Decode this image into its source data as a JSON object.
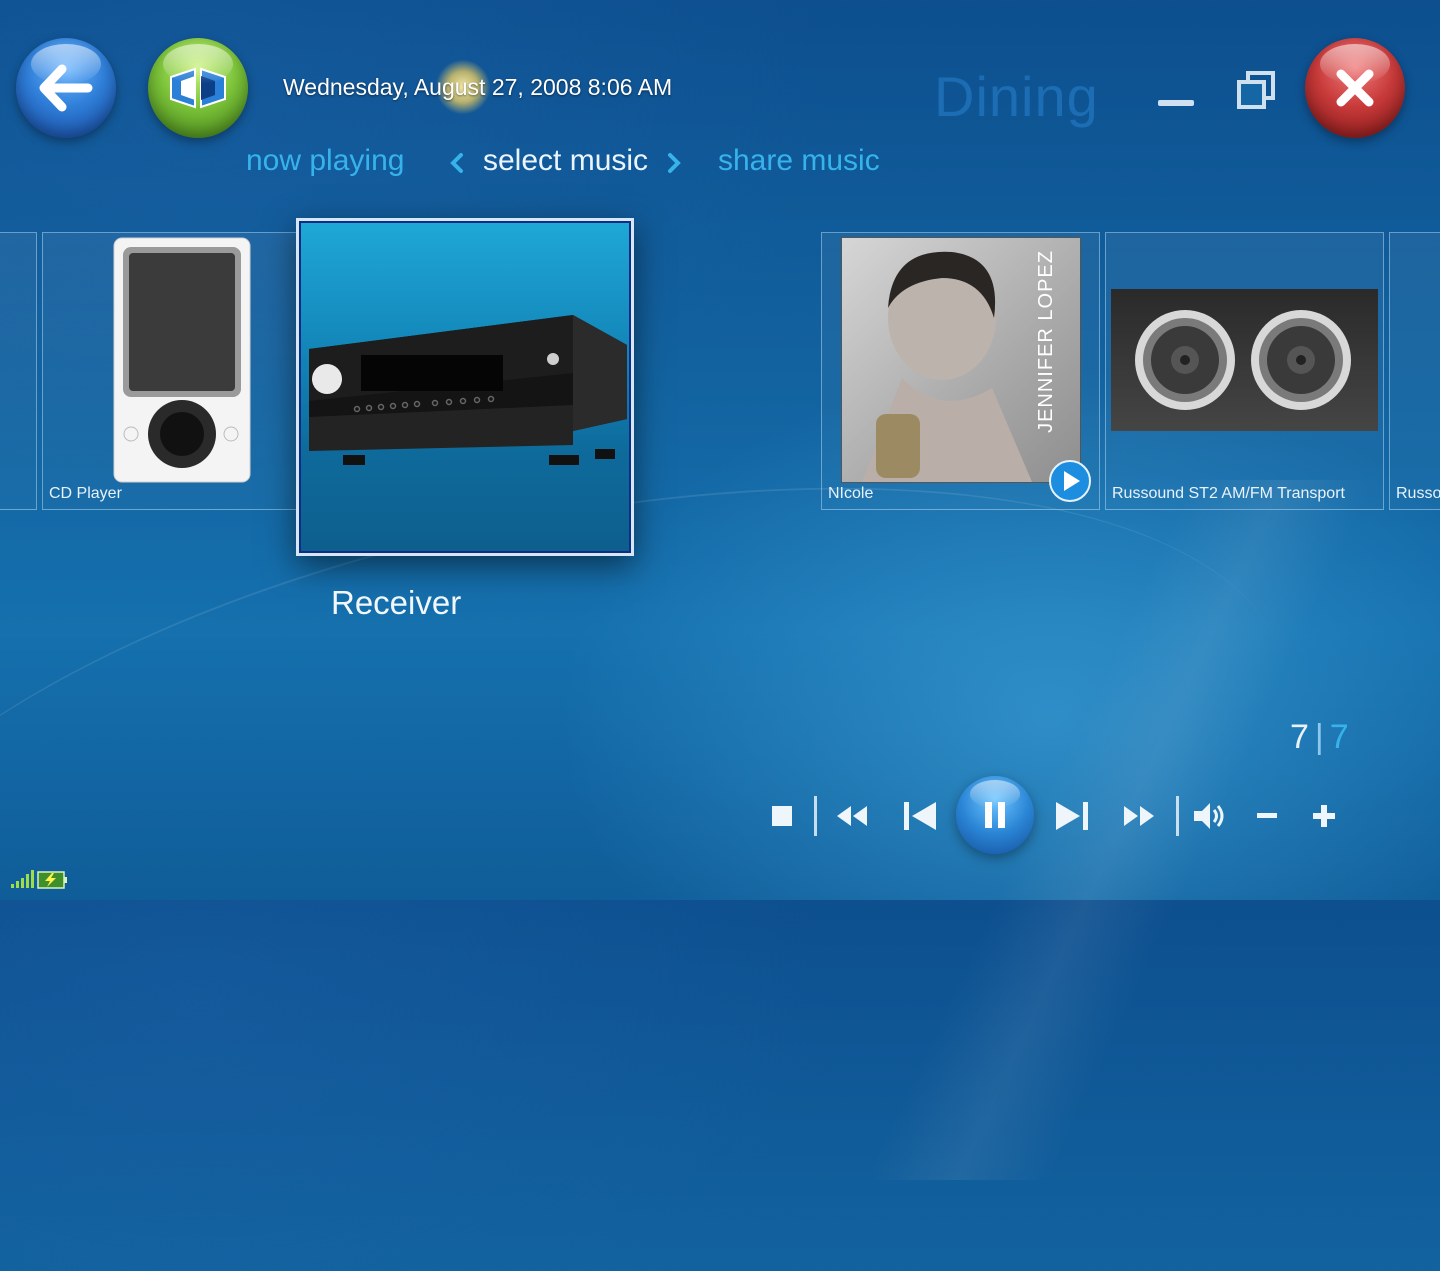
{
  "header": {
    "datetime": "Wednesday, August 27, 2008 8:06 AM",
    "room_title": "Dining"
  },
  "nav": {
    "now_playing": "now playing",
    "select_music": "select music",
    "share_music": "share music"
  },
  "sources": {
    "items": [
      {
        "label": "CD Player",
        "icon": "portable-player-icon"
      },
      {
        "label": "Receiver",
        "icon": "av-receiver-icon",
        "selected": true
      },
      {
        "label": "NIcole",
        "icon": "album-art",
        "album_text": "JENNIFER LOPEZ"
      },
      {
        "label": "Russound ST2 AM/FM Transport",
        "icon": "speaker-pair-icon"
      },
      {
        "label": "Russo",
        "icon": "source-icon"
      }
    ]
  },
  "counter": {
    "current": "7",
    "separator": "|",
    "total": "7"
  },
  "transport": {
    "buttons": [
      "stop-icon",
      "rewind-icon",
      "previous-icon",
      "pause-icon",
      "next-icon",
      "fast-forward-icon",
      "volume-icon",
      "minus-icon",
      "plus-icon"
    ]
  },
  "colors": {
    "accent": "#37b3ec",
    "background": "#12629f",
    "close": "#c83a3a",
    "home": "#7cc33a",
    "back": "#2f7fd9"
  }
}
